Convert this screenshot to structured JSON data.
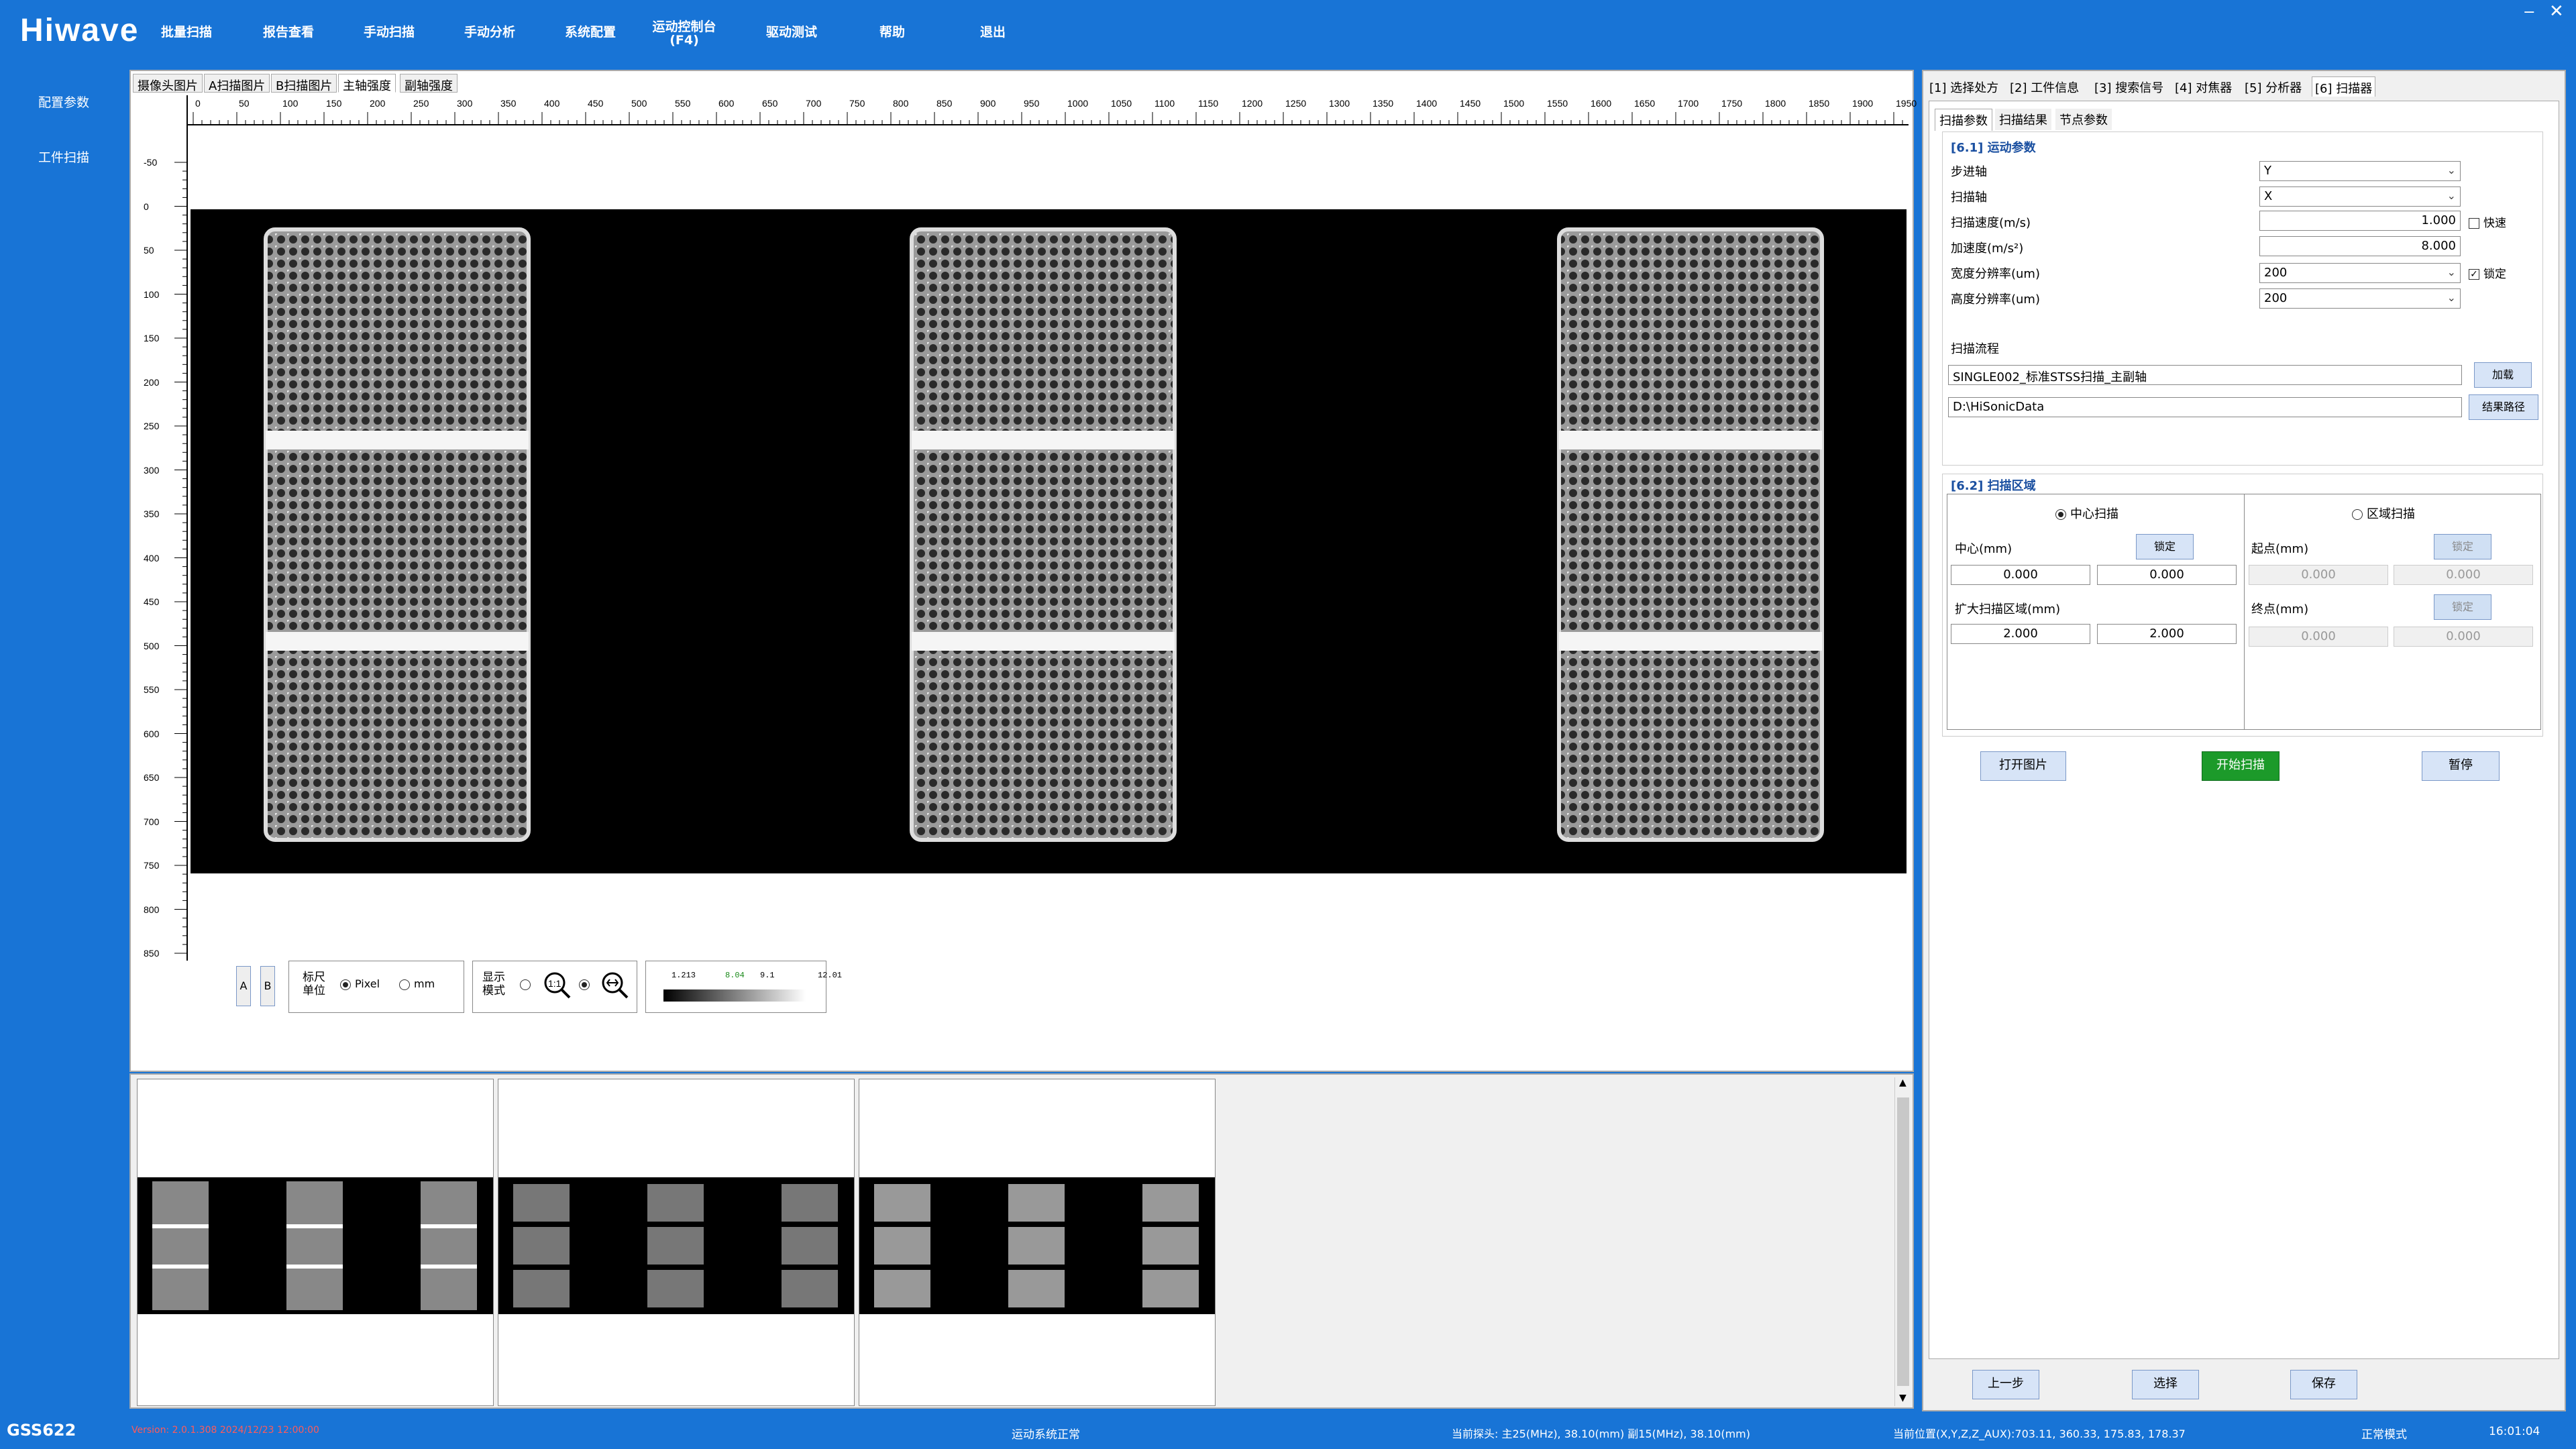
{
  "app": {
    "logo": "Hiwave",
    "window_controls": {
      "minimize": "‒",
      "close": "✕"
    }
  },
  "nav": [
    "批量扫描",
    "报告查看",
    "手动扫描",
    "手动分析",
    "系统配置",
    "运动控制台\n(F4)",
    "驱动测试",
    "帮助",
    "退出"
  ],
  "left_nav": [
    "配置参数",
    "工件扫描"
  ],
  "image_tabs": [
    "摄像头图片",
    "A扫描图片",
    "B扫描图片",
    "主轴强度",
    "副轴强度"
  ],
  "active_image_tab": 3,
  "ruler_top_ticks": [
    "0",
    "50",
    "100",
    "150",
    "200",
    "250",
    "300",
    "350",
    "400",
    "450",
    "500",
    "550",
    "600",
    "650",
    "700",
    "750",
    "800",
    "850",
    "900",
    "950",
    "1000",
    "1050",
    "1100",
    "1150",
    "1200",
    "1250",
    "1300",
    "1350",
    "1400",
    "1450",
    "1500",
    "1550",
    "1600",
    "1650",
    "1700",
    "1750",
    "1800",
    "1850",
    "1900",
    "1950"
  ],
  "ruler_left_ticks": [
    "-50",
    "0",
    "50",
    "100",
    "150",
    "200",
    "250",
    "300",
    "350",
    "400",
    "450",
    "500",
    "550",
    "600",
    "650",
    "700",
    "750",
    "800",
    "850"
  ],
  "tools": {
    "ab_buttons": [
      "A",
      "B"
    ],
    "unit_label": "标尺\n单位",
    "unit_options": [
      "Pixel",
      "mm"
    ],
    "display_label": "显示\n模式",
    "zoom_1to1": "1:1",
    "colorbar_ticks": [
      "1.213",
      "8.04",
      "9.1",
      "12.01"
    ]
  },
  "right_tabs": [
    "[1] 选择处方",
    "[2] 工件信息",
    "[3] 搜索信号",
    "[4] 对焦器",
    "[5] 分析器",
    "[6] 扫描器"
  ],
  "active_right_tab": 5,
  "sub_tabs": [
    "扫描参数",
    "扫描结果",
    "节点参数"
  ],
  "motion": {
    "title": "[6.1] 运动参数",
    "step_axis_label": "步进轴",
    "step_axis_value": "Y",
    "scan_axis_label": "扫描轴",
    "scan_axis_value": "X",
    "scan_speed_label": "扫描速度(m/s)",
    "scan_speed_value": "1.000",
    "fast_label": "快速",
    "accel_label": "加速度(m/s²)",
    "accel_value": "8.000",
    "width_res_label": "宽度分辨率(um)",
    "width_res_value": "200",
    "lock_label": "锁定",
    "height_res_label": "高度分辨率(um)",
    "height_res_value": "200",
    "flow_label": "扫描流程",
    "flow_value": "SINGLE002_标准STSS扫描_主副轴",
    "load_button": "加载",
    "path_value": "D:\\HiSonicData",
    "path_button": "结果路径"
  },
  "area": {
    "title": "[6.2] 扫描区域",
    "center_scan": "中心扫描",
    "region_scan": "区域扫描",
    "center_label": "中心(mm)",
    "lock": "锁定",
    "center_x": "0.000",
    "center_y": "0.000",
    "expand_label": "扩大扫描区域(mm)",
    "expand_x": "2.000",
    "expand_y": "2.000",
    "start_label": "起点(mm)",
    "start_x": "0.000",
    "start_y": "0.000",
    "end_label": "终点(mm)",
    "end_x": "0.000",
    "end_y": "0.000"
  },
  "actions": {
    "open_image": "打开图片",
    "start_scan": "开始扫描",
    "pause": "暂停"
  },
  "footer_buttons": {
    "prev": "上一步",
    "select": "选择",
    "save": "保存"
  },
  "status": {
    "device": "GSS622",
    "version": "Version: 2.0.1.308  2024/12/23 12:00:00",
    "motion": "运动系统正常",
    "probe": "当前探头: 主25(MHz), 38.10(mm) 副15(MHz), 38.10(mm)",
    "position": "当前位置(X,Y,Z,Z_AUX):703.11, 360.33, 175.83, 178.37",
    "mode": "正常模式",
    "time": "16:01:04"
  }
}
